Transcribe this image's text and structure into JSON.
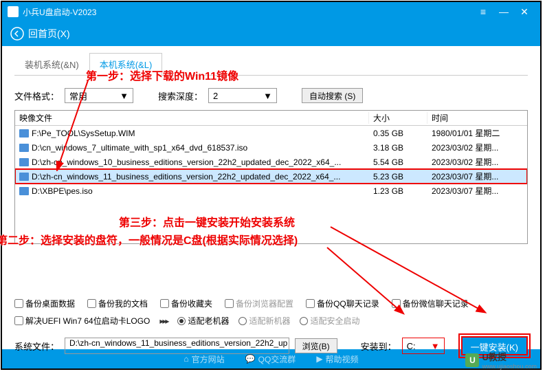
{
  "window": {
    "title": "小兵U盘启动-V2023"
  },
  "nav": {
    "back": "回首页(X)"
  },
  "tabs": {
    "install": "装机系统(&N)",
    "local": "本机系统(&L)"
  },
  "filters": {
    "format_label": "文件格式：",
    "format_value": "常用",
    "depth_label": "搜索深度：",
    "depth_value": "2",
    "auto_search": "自动搜索 (S)"
  },
  "table": {
    "head_image": "映像文件",
    "head_size": "大小",
    "head_time": "时间",
    "rows": [
      {
        "path": "F:\\Pe_TOOL\\SysSetup.WIM",
        "size": "0.35 GB",
        "time": "1980/01/01 星期二"
      },
      {
        "path": "D:\\cn_windows_7_ultimate_with_sp1_x64_dvd_618537.iso",
        "size": "3.18 GB",
        "time": "2023/03/02 星期..."
      },
      {
        "path": "D:\\zh-cn_windows_10_business_editions_version_22h2_updated_dec_2022_x64_...",
        "size": "5.54 GB",
        "time": "2023/03/02 星期..."
      },
      {
        "path": "D:\\zh-cn_windows_11_business_editions_version_22h2_updated_dec_2022_x64_...",
        "size": "5.23 GB",
        "time": "2023/03/07 星期..."
      },
      {
        "path": "D:\\XBPE\\pes.iso",
        "size": "1.23 GB",
        "time": "2023/03/07 星期..."
      }
    ]
  },
  "checks": {
    "c1": "备份桌面数据",
    "c2": "备份我的文档",
    "c3": "备份收藏夹",
    "c4": "备份浏览器配置",
    "c5": "备份QQ聊天记录",
    "c6": "备份微信聊天记录",
    "c7": "解决UEFI Win7 64位启动卡LOGO",
    "r1": "适配老机器",
    "r2": "适配新机器",
    "r3": "适配安全启动"
  },
  "bottom": {
    "sysfile_label": "系统文件：",
    "sysfile_value": "D:\\zh-cn_windows_11_business_editions_version_22h2_up",
    "browse": "浏览(B)",
    "install_to": "安装到：",
    "drive": "C:",
    "install": "一键安装(K)"
  },
  "footer": {
    "f1": "官方网站",
    "f2": "QQ交流群",
    "f3": "帮助视频"
  },
  "annotations": {
    "step1": "第一步：选择下载的Win11镜像",
    "step2": "第二步：选择安装的盘符，一般情况是C盘(根据实际情况选择)",
    "step3": "第三步：点击一键安装开始安装系统"
  },
  "watermark": {
    "name": "U教授",
    "url": "www.ujiaoshou.com"
  }
}
